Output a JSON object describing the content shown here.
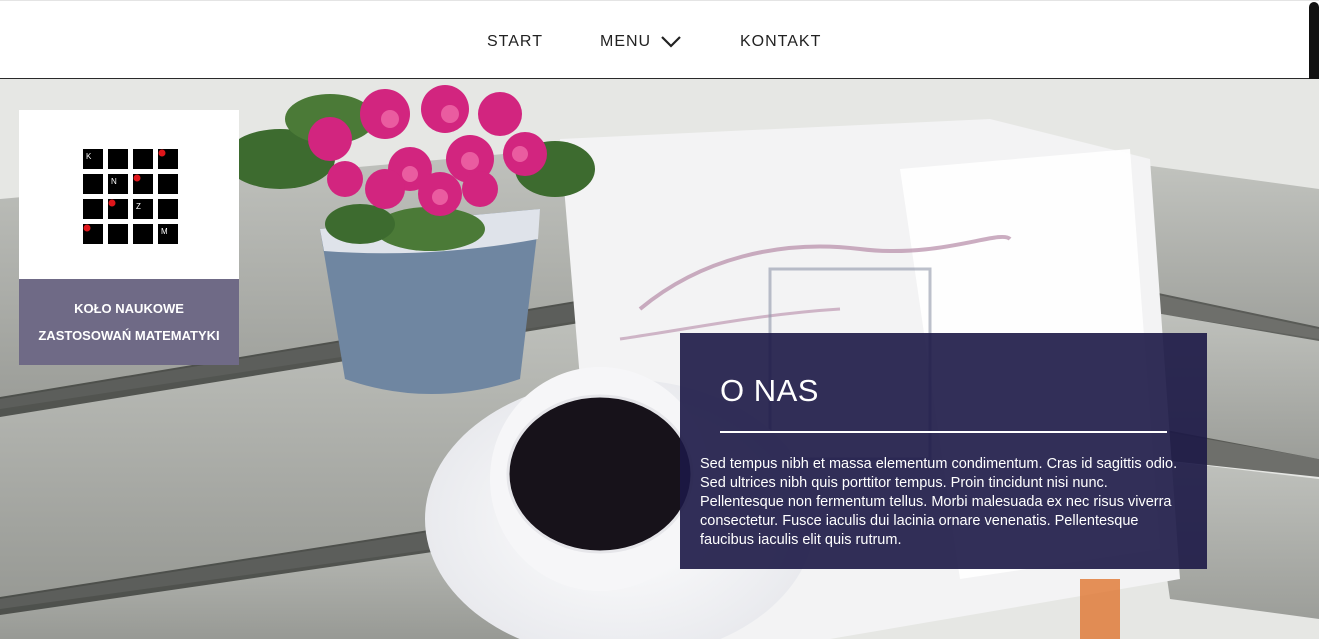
{
  "nav": {
    "start": "START",
    "menu": "MENU",
    "kontakt": "KONTAKT"
  },
  "logo": {
    "letters": [
      "K",
      "N",
      "Z",
      "M"
    ],
    "caption_line1": "KOŁO NAUKOWE",
    "caption_line2": "ZASTOSOWAŃ MATEMATYKI"
  },
  "about": {
    "title": "O NAS",
    "text": "Sed tempus nibh et massa elementum condimentum. Cras id sagittis odio. Sed ultrices nibh quis porttitor tempus. Proin tincidunt nisi nunc. Pellentesque non fermentum tellus. Morbi malesuada ex nec risus viverra consectetur. Fusce iaculis dui lacinia ornare venenatis. Pellentesque faucibus iaculis elit quis rutrum."
  },
  "colors": {
    "nav_bg": "#ffffff",
    "logo_caption_bg": "#6f6a86",
    "about_bg": "#1c1846",
    "logo_dot": "#e0161b"
  },
  "icons": {
    "menu_chevron": "chevron-down-icon"
  }
}
